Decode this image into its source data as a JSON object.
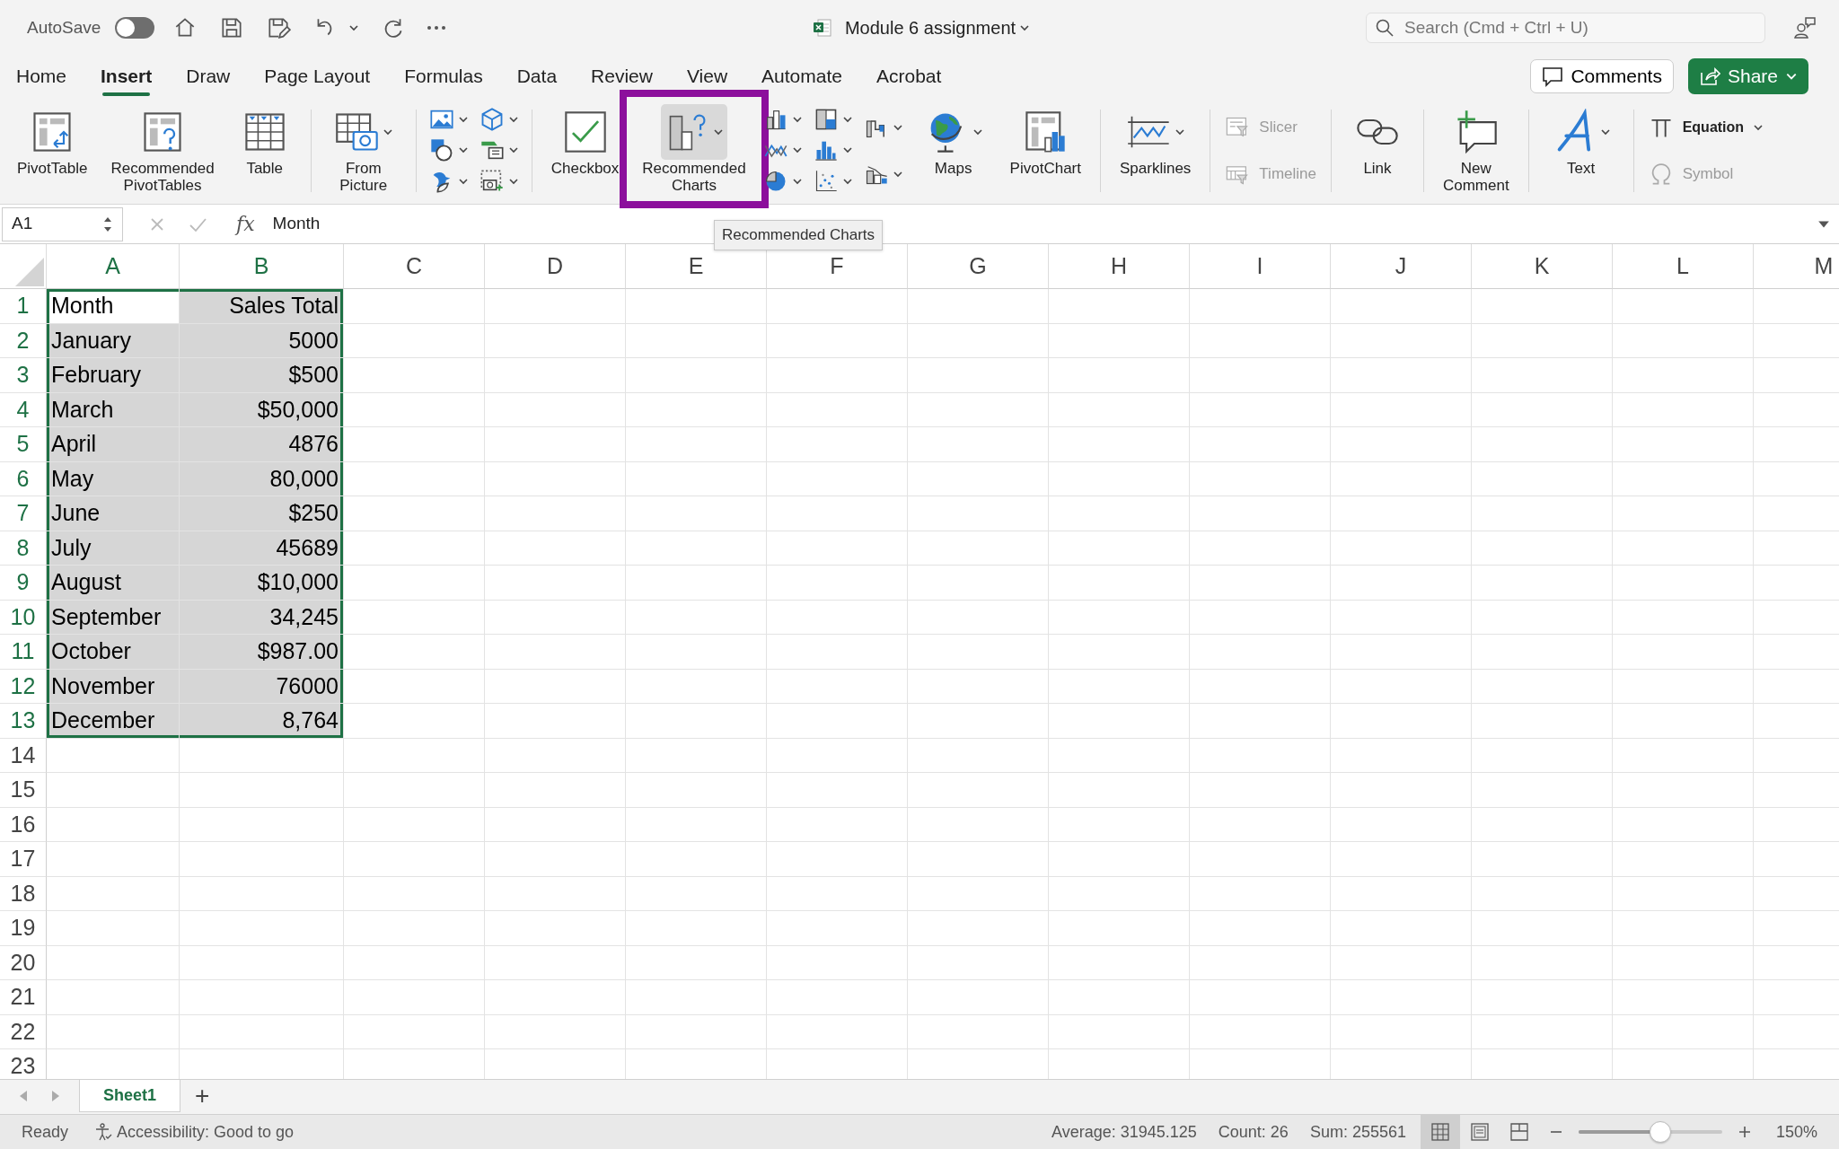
{
  "title_bar": {
    "autosave": {
      "label": "AutoSave",
      "on": false
    },
    "document_title": "Module 6 assignment",
    "search": {
      "placeholder": "Search (Cmd + Ctrl + U)"
    }
  },
  "ribbon_tabs": [
    {
      "label": "Home",
      "selected": false
    },
    {
      "label": "Insert",
      "selected": true
    },
    {
      "label": "Draw",
      "selected": false
    },
    {
      "label": "Page Layout",
      "selected": false
    },
    {
      "label": "Formulas",
      "selected": false
    },
    {
      "label": "Data",
      "selected": false
    },
    {
      "label": "Review",
      "selected": false
    },
    {
      "label": "View",
      "selected": false
    },
    {
      "label": "Automate",
      "selected": false
    },
    {
      "label": "Acrobat",
      "selected": false
    }
  ],
  "comments_button": "Comments",
  "share_button": "Share",
  "ribbon": {
    "groups": [
      {
        "columns": [
          [
            {
              "kind": "large",
              "label": "PivotTable"
            }
          ],
          [
            {
              "kind": "large",
              "label": "Recommended PivotTables"
            }
          ],
          [
            {
              "kind": "large",
              "label": "Table"
            }
          ]
        ]
      },
      {
        "columns": [
          [
            {
              "kind": "large",
              "label": "From Picture",
              "dropdown": true
            }
          ]
        ]
      },
      {
        "columns": [
          [
            {
              "kind": "icon",
              "dropdown": true
            },
            {
              "kind": "icon",
              "dropdown": true
            },
            {
              "kind": "icon",
              "dropdown": true
            }
          ],
          [
            {
              "kind": "icon",
              "dropdown": true
            },
            {
              "kind": "icon",
              "dropdown": true
            },
            {
              "kind": "icon",
              "dropdown": true
            }
          ]
        ]
      },
      {
        "columns": [
          [
            {
              "kind": "large",
              "label": "Checkbox"
            }
          ],
          [
            {
              "kind": "large",
              "label": "Recommended Charts",
              "dropdown": true,
              "hovered": true,
              "highlighted": true
            }
          ],
          [
            {
              "kind": "icon",
              "dropdown": true
            },
            {
              "kind": "icon",
              "dropdown": true
            },
            {
              "kind": "icon",
              "dropdown": true
            }
          ],
          [
            {
              "kind": "icon",
              "dropdown": true
            },
            {
              "kind": "icon",
              "dropdown": true
            },
            {
              "kind": "icon",
              "dropdown": true
            }
          ],
          [
            {
              "kind": "icon",
              "dropdown": true
            },
            {
              "kind": "icon",
              "dropdown": true
            }
          ],
          [
            {
              "kind": "large",
              "label": "Maps",
              "dropdown": true
            }
          ],
          [
            {
              "kind": "large",
              "label": "PivotChart"
            }
          ]
        ]
      },
      {
        "columns": [
          [
            {
              "kind": "large",
              "label": "Sparklines",
              "dropdown": true
            }
          ]
        ]
      },
      {
        "columns": [
          [
            {
              "kind": "small",
              "label": "Slicer",
              "disabled": true
            },
            {
              "kind": "small",
              "label": "Timeline",
              "disabled": true
            }
          ]
        ]
      },
      {
        "columns": [
          [
            {
              "kind": "large",
              "label": "Link"
            }
          ]
        ]
      },
      {
        "columns": [
          [
            {
              "kind": "large",
              "label": "New Comment"
            }
          ]
        ]
      },
      {
        "columns": [
          [
            {
              "kind": "large",
              "label": "Text",
              "dropdown": true
            }
          ]
        ]
      },
      {
        "columns": [
          [
            {
              "kind": "small",
              "label": "Equation",
              "dropdown": true,
              "bold": true
            },
            {
              "kind": "small",
              "label": "Symbol",
              "disabled": true
            }
          ]
        ]
      }
    ]
  },
  "tooltip": "Recommended Charts",
  "formula_bar": {
    "name_box": "A1",
    "function_label": "fx",
    "formula": "Month"
  },
  "sheet": {
    "columns": [
      {
        "label": "A",
        "selected": true
      },
      {
        "label": "B",
        "selected": true
      },
      {
        "label": "C",
        "selected": false
      },
      {
        "label": "D",
        "selected": false
      },
      {
        "label": "E",
        "selected": false
      },
      {
        "label": "F",
        "selected": false
      },
      {
        "label": "G",
        "selected": false
      },
      {
        "label": "H",
        "selected": false
      },
      {
        "label": "I",
        "selected": false
      },
      {
        "label": "J",
        "selected": false
      },
      {
        "label": "K",
        "selected": false
      },
      {
        "label": "L",
        "selected": false
      },
      {
        "label": "M",
        "selected": false
      }
    ],
    "rows": [
      {
        "number": "1",
        "selected": true,
        "cells": [
          {
            "text": "Month",
            "align_right": false,
            "selected": true,
            "active": true
          },
          {
            "text": "Sales Total",
            "align_right": true,
            "selected": true,
            "active": false
          }
        ]
      },
      {
        "number": "2",
        "selected": true,
        "cells": [
          {
            "text": "January",
            "align_right": false,
            "selected": true,
            "active": false
          },
          {
            "text": "5000",
            "align_right": true,
            "selected": true,
            "active": false
          }
        ]
      },
      {
        "number": "3",
        "selected": true,
        "cells": [
          {
            "text": "February",
            "align_right": false,
            "selected": true,
            "active": false
          },
          {
            "text": "$500",
            "align_right": true,
            "selected": true,
            "active": false
          }
        ]
      },
      {
        "number": "4",
        "selected": true,
        "cells": [
          {
            "text": "March",
            "align_right": false,
            "selected": true,
            "active": false
          },
          {
            "text": "$50,000",
            "align_right": true,
            "selected": true,
            "active": false
          }
        ]
      },
      {
        "number": "5",
        "selected": true,
        "cells": [
          {
            "text": "April",
            "align_right": false,
            "selected": true,
            "active": false
          },
          {
            "text": "4876",
            "align_right": true,
            "selected": true,
            "active": false
          }
        ]
      },
      {
        "number": "6",
        "selected": true,
        "cells": [
          {
            "text": "May",
            "align_right": false,
            "selected": true,
            "active": false
          },
          {
            "text": "80,000",
            "align_right": true,
            "selected": true,
            "active": false
          }
        ]
      },
      {
        "number": "7",
        "selected": true,
        "cells": [
          {
            "text": "June",
            "align_right": false,
            "selected": true,
            "active": false
          },
          {
            "text": "$250",
            "align_right": true,
            "selected": true,
            "active": false
          }
        ]
      },
      {
        "number": "8",
        "selected": true,
        "cells": [
          {
            "text": "July",
            "align_right": false,
            "selected": true,
            "active": false
          },
          {
            "text": "45689",
            "align_right": true,
            "selected": true,
            "active": false
          }
        ]
      },
      {
        "number": "9",
        "selected": true,
        "cells": [
          {
            "text": "August",
            "align_right": false,
            "selected": true,
            "active": false
          },
          {
            "text": "$10,000",
            "align_right": true,
            "selected": true,
            "active": false
          }
        ]
      },
      {
        "number": "10",
        "selected": true,
        "cells": [
          {
            "text": "September",
            "align_right": false,
            "selected": true,
            "active": false
          },
          {
            "text": "34,245",
            "align_right": true,
            "selected": true,
            "active": false
          }
        ]
      },
      {
        "number": "11",
        "selected": true,
        "cells": [
          {
            "text": "October",
            "align_right": false,
            "selected": true,
            "active": false
          },
          {
            "text": "$987.00",
            "align_right": true,
            "selected": true,
            "active": false
          }
        ]
      },
      {
        "number": "12",
        "selected": true,
        "cells": [
          {
            "text": "November",
            "align_right": false,
            "selected": true,
            "active": false
          },
          {
            "text": "76000",
            "align_right": true,
            "selected": true,
            "active": false
          }
        ]
      },
      {
        "number": "13",
        "selected": true,
        "cells": [
          {
            "text": "December",
            "align_right": false,
            "selected": true,
            "active": false
          },
          {
            "text": "8,764",
            "align_right": true,
            "selected": true,
            "active": false
          }
        ]
      },
      {
        "number": "14",
        "selected": false
      },
      {
        "number": "15",
        "selected": false
      },
      {
        "number": "16",
        "selected": false
      },
      {
        "number": "17",
        "selected": false
      },
      {
        "number": "18",
        "selected": false
      },
      {
        "number": "19",
        "selected": false
      },
      {
        "number": "20",
        "selected": false
      },
      {
        "number": "21",
        "selected": false
      },
      {
        "number": "22",
        "selected": false
      },
      {
        "number": "23",
        "selected": false
      }
    ]
  },
  "sheet_tabs": [
    {
      "label": "Sheet1",
      "selected": true
    }
  ],
  "add_sheet": "+",
  "status_bar": {
    "mode": "Ready",
    "accessibility": "Accessibility: Good to go",
    "average": "Average: 31945.125",
    "count": "Count: 26",
    "sum": "Sum: 255561",
    "views": [
      {
        "selected": true
      },
      {
        "selected": false
      },
      {
        "selected": false
      }
    ],
    "zoom": {
      "level": 0.57,
      "reading": "150%"
    }
  }
}
